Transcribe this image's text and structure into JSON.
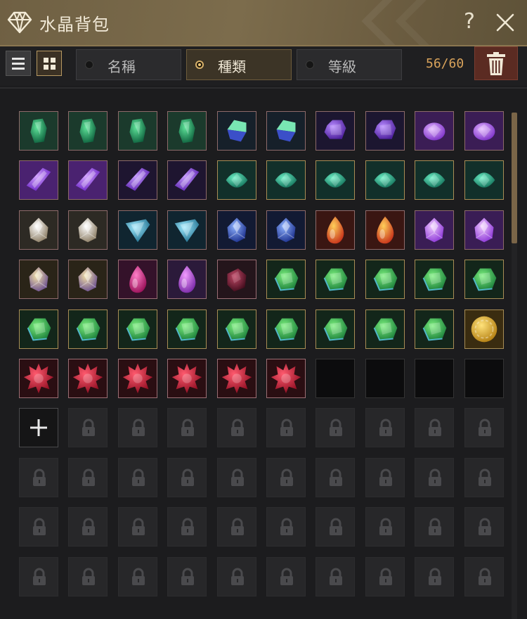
{
  "window": {
    "title": "水晶背包"
  },
  "header": {
    "help_label": "?",
    "close_icon": "close-icon",
    "diamond_icon": "diamond-icon"
  },
  "toolbar": {
    "view_modes": [
      {
        "icon": "list-view-icon",
        "active": false
      },
      {
        "icon": "grid-view-icon",
        "active": true
      }
    ],
    "filters": [
      {
        "label": "名稱",
        "selected": false
      },
      {
        "label": "種類",
        "selected": true
      },
      {
        "label": "等級",
        "selected": false
      }
    ],
    "capacity": "56/60",
    "trash_icon": "trash-icon"
  },
  "colors": {
    "accent": "#d9a35b",
    "header_bg": "#7c6c4c",
    "trash_bg": "#5b2b22",
    "panel_bg": "#1c1c1e"
  },
  "inventory": {
    "columns": 10,
    "rows_visible": 10,
    "slots": [
      {
        "type": "emerald-shard"
      },
      {
        "type": "emerald-shard"
      },
      {
        "type": "emerald-shard"
      },
      {
        "type": "emerald-shard"
      },
      {
        "type": "green-blue-shard"
      },
      {
        "type": "green-blue-shard"
      },
      {
        "type": "amethyst-hexagon"
      },
      {
        "type": "amethyst-hexagon"
      },
      {
        "type": "amethyst-oval"
      },
      {
        "type": "amethyst-oval"
      },
      {
        "type": "violet-crystal-glow"
      },
      {
        "type": "violet-crystal-glow"
      },
      {
        "type": "violet-crystal"
      },
      {
        "type": "violet-crystal"
      },
      {
        "type": "teal-marquise"
      },
      {
        "type": "teal-marquise"
      },
      {
        "type": "teal-marquise"
      },
      {
        "type": "teal-marquise"
      },
      {
        "type": "teal-marquise"
      },
      {
        "type": "teal-marquise"
      },
      {
        "type": "silver-cluster"
      },
      {
        "type": "silver-cluster"
      },
      {
        "type": "cyan-shard"
      },
      {
        "type": "cyan-shard"
      },
      {
        "type": "sapphire-cluster"
      },
      {
        "type": "sapphire-cluster"
      },
      {
        "type": "fire-teardrop"
      },
      {
        "type": "fire-teardrop"
      },
      {
        "type": "amethyst-cluster"
      },
      {
        "type": "amethyst-cluster"
      },
      {
        "type": "rainbow-cluster"
      },
      {
        "type": "rainbow-cluster"
      },
      {
        "type": "magenta-teardrop"
      },
      {
        "type": "violet-teardrop"
      },
      {
        "type": "garnet-rough"
      },
      {
        "type": "green-gem"
      },
      {
        "type": "green-gem"
      },
      {
        "type": "green-gem"
      },
      {
        "type": "green-gem"
      },
      {
        "type": "green-gem"
      },
      {
        "type": "green-gem"
      },
      {
        "type": "green-gem"
      },
      {
        "type": "green-gem"
      },
      {
        "type": "green-gem"
      },
      {
        "type": "green-gem"
      },
      {
        "type": "green-gem"
      },
      {
        "type": "green-gem"
      },
      {
        "type": "green-gem"
      },
      {
        "type": "green-gem"
      },
      {
        "type": "gold-orb"
      },
      {
        "type": "ruby-cluster"
      },
      {
        "type": "ruby-cluster"
      },
      {
        "type": "ruby-cluster"
      },
      {
        "type": "ruby-cluster"
      },
      {
        "type": "ruby-cluster"
      },
      {
        "type": "ruby-cluster"
      },
      {
        "type": "empty"
      },
      {
        "type": "empty"
      },
      {
        "type": "empty"
      },
      {
        "type": "empty"
      },
      {
        "type": "add-slot"
      }
    ],
    "locked_icon": "lock-icon"
  }
}
